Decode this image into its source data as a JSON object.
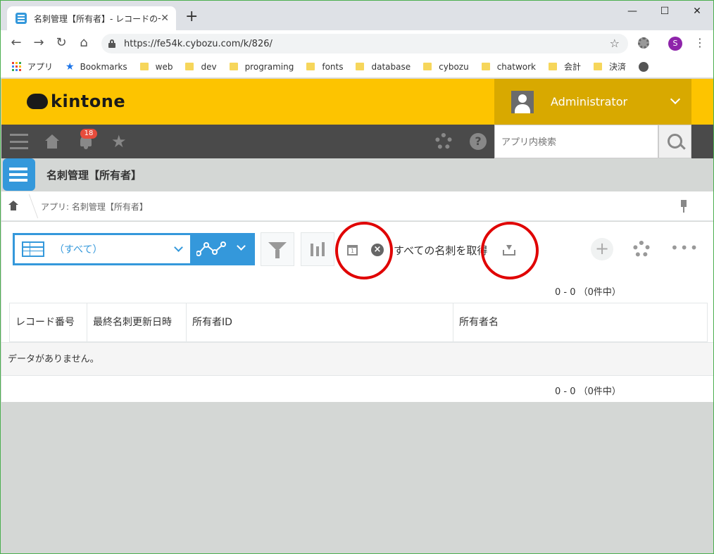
{
  "browser": {
    "tab_title": "名刺管理【所有者】- レコードの一覧",
    "tab_close": "✕",
    "new_tab": "+",
    "url": "https://fe54k.cybozu.com/k/826/",
    "profile_initial": "S",
    "window_controls": [
      "—",
      "☐",
      "✕"
    ]
  },
  "bookmarks": [
    {
      "type": "apps",
      "label": "アプリ"
    },
    {
      "type": "star",
      "label": "Bookmarks"
    },
    {
      "type": "folder",
      "label": "web"
    },
    {
      "type": "folder",
      "label": "dev"
    },
    {
      "type": "folder",
      "label": "programing"
    },
    {
      "type": "folder",
      "label": "fonts"
    },
    {
      "type": "folder",
      "label": "database"
    },
    {
      "type": "folder",
      "label": "cybozu"
    },
    {
      "type": "folder",
      "label": "chatwork"
    },
    {
      "type": "folder",
      "label": "会計"
    },
    {
      "type": "folder",
      "label": "決済"
    },
    {
      "type": "globe",
      "label": ""
    }
  ],
  "kintone": {
    "logo": "kintone",
    "user_name": "Administrator",
    "notification_count": "18",
    "search_placeholder": "アプリ内検索",
    "help_glyph": "?"
  },
  "app": {
    "title": "名刺管理【所有者】",
    "breadcrumb": "アプリ: 名刺管理【所有者】"
  },
  "toolbar": {
    "view_label": "（すべて）",
    "calendar_glyph": "1",
    "clear_glyph": "×",
    "fetch_label": "すべての名刺を取得",
    "add_glyph": "+",
    "more_glyph": "•••"
  },
  "table": {
    "columns": [
      "レコード番号",
      "最終名刺更新日時",
      "所有者ID",
      "所有者名"
    ],
    "empty_message": "データがありません。",
    "pager_top": "0 - 0 （0件中）",
    "pager_bottom": "0 - 0 （0件中）"
  },
  "colors": {
    "kintone_yellow": "#fdc400",
    "nav_dark": "#4a4a4a",
    "accent_blue": "#3498db",
    "annotation_red": "#e00000"
  }
}
